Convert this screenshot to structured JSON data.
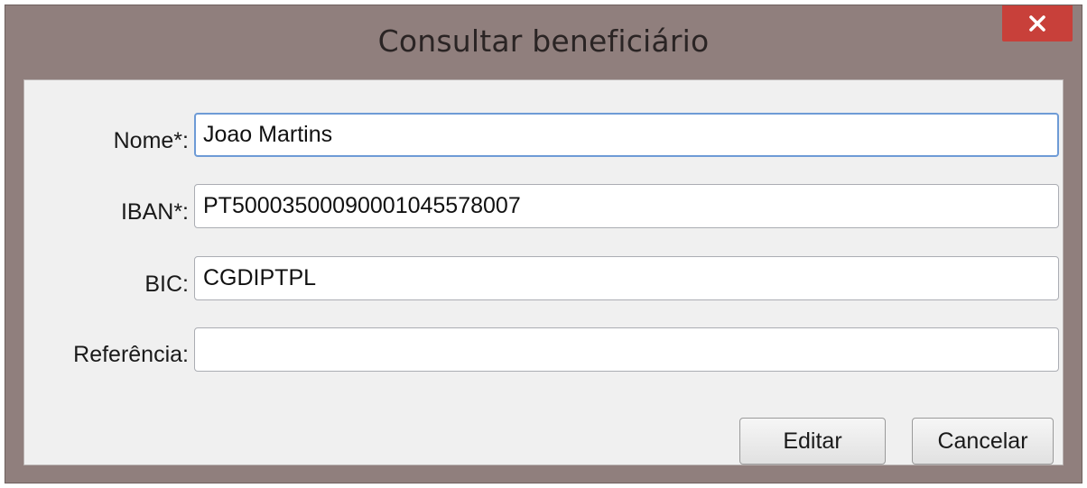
{
  "window": {
    "title": "Consultar beneficiário",
    "close_icon": "close-icon"
  },
  "form": {
    "nome": {
      "label": "Nome*:",
      "value": "Joao Martins"
    },
    "iban": {
      "label": "IBAN*:",
      "value": "PT50003500090001045578007"
    },
    "bic": {
      "label": "BIC:",
      "value": "CGDIPTPL"
    },
    "referencia": {
      "label": "Referência:",
      "value": ""
    }
  },
  "buttons": {
    "edit_label": "Editar",
    "cancel_label": "Cancelar"
  },
  "colors": {
    "titlebar": "#907f7d",
    "close_button": "#c8403a",
    "client_background": "#f0f0f0",
    "focus_border": "#6e9bd6"
  }
}
